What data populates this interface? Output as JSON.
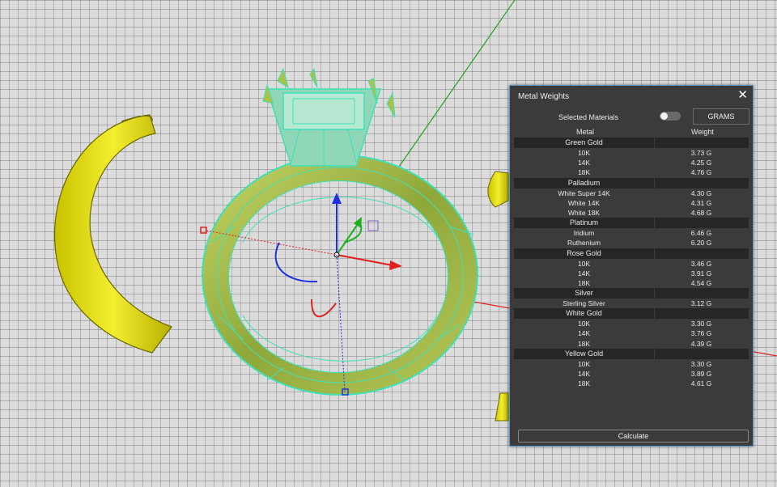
{
  "dialog": {
    "title": "Metal Weights",
    "close_glyph": "✕",
    "selected_materials_label": "Selected Materials",
    "selected_materials_on": false,
    "unit_button": "GRAMS",
    "col_metal": "Metal",
    "col_weight": "Weight",
    "calculate_label": "Calculate"
  },
  "groups": [
    {
      "name": "Green Gold",
      "rows": [
        {
          "metal": "10K",
          "weight": "3.73 G"
        },
        {
          "metal": "14K",
          "weight": "4.25 G"
        },
        {
          "metal": "18K",
          "weight": "4.76 G"
        }
      ]
    },
    {
      "name": "Palladium",
      "rows": [
        {
          "metal": "White Super 14K",
          "weight": "4.30 G"
        },
        {
          "metal": "White 14K",
          "weight": "4.31 G"
        },
        {
          "metal": "White 18K",
          "weight": "4.68 G"
        }
      ]
    },
    {
      "name": "Platinum",
      "rows": [
        {
          "metal": "Iridium",
          "weight": "6.46 G"
        },
        {
          "metal": "Ruthenium",
          "weight": "6.20 G"
        }
      ]
    },
    {
      "name": "Rose Gold",
      "rows": [
        {
          "metal": "10K",
          "weight": "3.46 G"
        },
        {
          "metal": "14K",
          "weight": "3.91 G"
        },
        {
          "metal": "18K",
          "weight": "4.54 G"
        }
      ]
    },
    {
      "name": "Silver",
      "rows": [
        {
          "metal": "Sterling Silver",
          "weight": "3.12 G"
        }
      ]
    },
    {
      "name": "White Gold",
      "rows": [
        {
          "metal": "10K",
          "weight": "3.30 G"
        },
        {
          "metal": "14K",
          "weight": "3.76 G"
        },
        {
          "metal": "18K",
          "weight": "4.39 G"
        }
      ]
    },
    {
      "name": "Yellow Gold",
      "rows": [
        {
          "metal": "10K",
          "weight": "3.30 G"
        },
        {
          "metal": "14K",
          "weight": "3.89 G"
        },
        {
          "metal": "18K",
          "weight": "4.61 G"
        }
      ]
    }
  ],
  "colors": {
    "ring_selected": "#3ee0b8",
    "ring_body": "#a9c24a",
    "yellow_parts": "#e8e010",
    "axis_x": "#e02020",
    "axis_y": "#1fb01f",
    "axis_z": "#2030e0",
    "panel_bg": "#3b3b3c",
    "panel_border": "#5a9bd3"
  }
}
